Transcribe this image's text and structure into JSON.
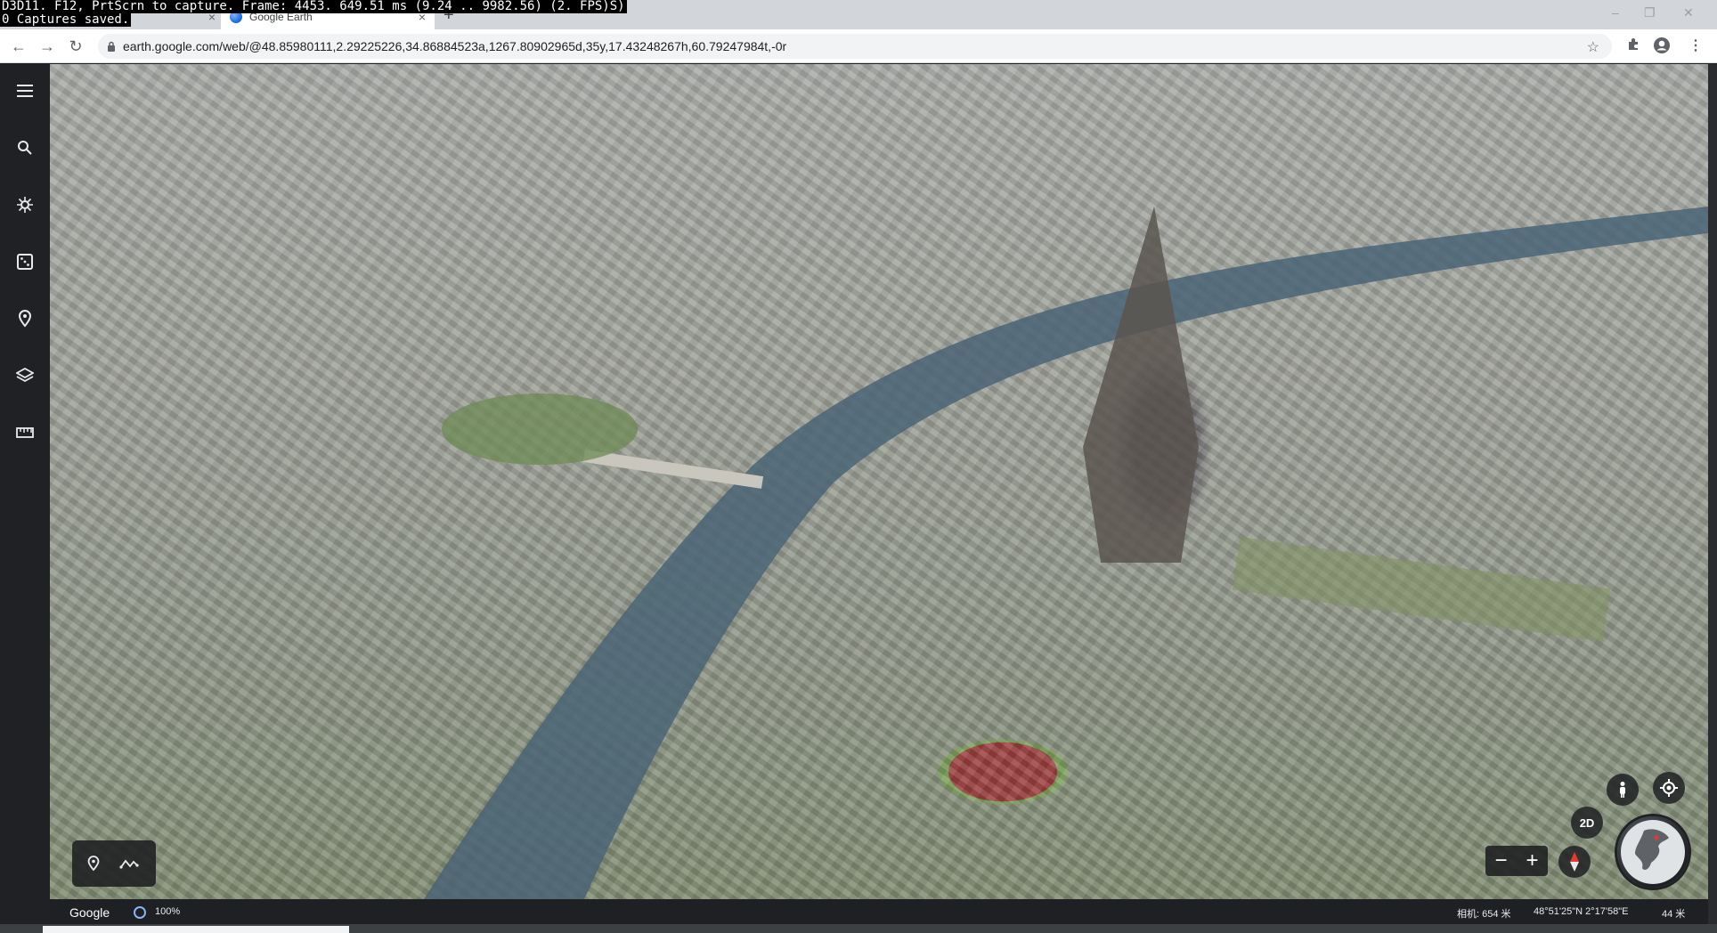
{
  "debug_overlay": {
    "line1": "D3D11. F12, PrtScrn to capture. Frame: 4453. 649.51 ms (9.24 .. 9982.56) (2. FPS)S)",
    "line2": "0 Captures saved."
  },
  "browser": {
    "tabs": [
      {
        "label": "",
        "close": "×"
      },
      {
        "label": "Google Earth",
        "close": "×",
        "active": true,
        "favicon": "google-earth-icon"
      }
    ],
    "new_tab": "+",
    "window_controls": [
      "–",
      "❐",
      "✕"
    ],
    "nav": {
      "back": "←",
      "forward": "→",
      "reload": "↻"
    },
    "url": "earth.google.com/web/@48.85980111,2.29225226,34.86884523a,1267.80902965d,35y,17.43248267h,60.79247984t,-0r",
    "toolbar_icons": [
      "star-icon",
      "extensions-icon",
      "profile-icon",
      "menu-icon"
    ]
  },
  "earth": {
    "left_rail": [
      {
        "name": "menu",
        "icon": "hamburger-icon"
      },
      {
        "name": "search",
        "icon": "search-icon"
      },
      {
        "name": "voyager",
        "icon": "voyager-icon"
      },
      {
        "name": "feeling-lucky",
        "icon": "dice-icon"
      },
      {
        "name": "projects",
        "icon": "bookmark-pin-icon"
      },
      {
        "name": "map-style",
        "icon": "layers-icon"
      },
      {
        "name": "measure",
        "icon": "ruler-icon"
      }
    ],
    "map_tools": [
      "placemark-icon",
      "path-icon"
    ],
    "view_controls": {
      "pegman": "pegman-icon",
      "my_location": "my-location-icon",
      "toggle_2d": "2D",
      "zoom_out": "−",
      "zoom_in": "+",
      "compass": "compass-icon",
      "globe": "globe-icon"
    },
    "status": {
      "logo": "Google",
      "loading": "100%",
      "camera": "相机: 654 米",
      "coords": "48°51'25\"N 2°17'58\"E",
      "elevation": "44 米"
    },
    "accent": "#8ab4f8"
  }
}
